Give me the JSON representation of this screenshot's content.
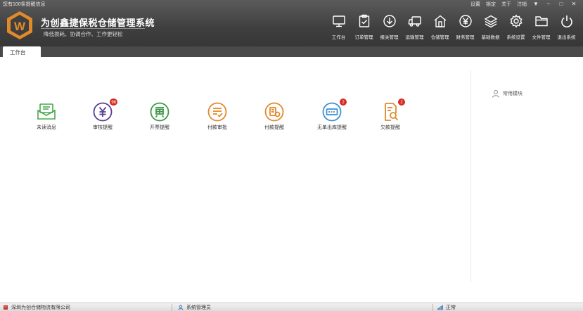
{
  "top_bar": {
    "notice": "您有100条提醒信息",
    "links": [
      "设置",
      "锁定",
      "关于",
      "注销"
    ],
    "window_buttons": [
      "▼",
      "−",
      "□",
      "✕"
    ]
  },
  "app": {
    "title": "为创鑫捷保税仓储管理系统",
    "slogan": "降低损耗、协调合作、工作更轻松",
    "logo_letter": "W",
    "accent": "#e08a2c"
  },
  "nav": [
    {
      "label": "工作台",
      "icon": "monitor-icon"
    },
    {
      "label": "订单管理",
      "icon": "clipboard-check-icon"
    },
    {
      "label": "报关管理",
      "icon": "download-circle-icon"
    },
    {
      "label": "运输管理",
      "icon": "truck-icon"
    },
    {
      "label": "仓储管理",
      "icon": "warehouse-icon"
    },
    {
      "label": "财务管理",
      "icon": "yen-circle-icon"
    },
    {
      "label": "基础数据",
      "icon": "layers-icon"
    },
    {
      "label": "系统设置",
      "icon": "gear-icon"
    },
    {
      "label": "文件管理",
      "icon": "folder-icon"
    },
    {
      "label": "退出系统",
      "icon": "power-icon"
    }
  ],
  "tabs": [
    {
      "label": "工作台"
    }
  ],
  "tiles": [
    {
      "label": "未读消息",
      "icon": "mail-icon",
      "color": "#49a84c",
      "badge": ""
    },
    {
      "label": "审核提醒",
      "icon": "yen-audit-icon",
      "color": "#5a3c93",
      "badge": "96"
    },
    {
      "label": "开票提醒",
      "icon": "invoice-icon",
      "color": "#3c9a44",
      "badge": ""
    },
    {
      "label": "付款审批",
      "icon": "payment-approval-icon",
      "color": "#e08a2c",
      "badge": ""
    },
    {
      "label": "付款提醒",
      "icon": "payment-reminder-icon",
      "color": "#e08a2c",
      "badge": ""
    },
    {
      "label": "无单出库提醒",
      "icon": "outbound-icon",
      "color": "#3d8fd1",
      "badge": "2"
    },
    {
      "label": "欠款提醒",
      "icon": "debt-search-icon",
      "color": "#e08a2c",
      "badge": "2"
    }
  ],
  "side_panel": {
    "label": "常用模块",
    "icon": "user-icon"
  },
  "status": {
    "company": "深圳为创仓储物流有限公司",
    "user": "系统管理员",
    "state": "正常"
  }
}
